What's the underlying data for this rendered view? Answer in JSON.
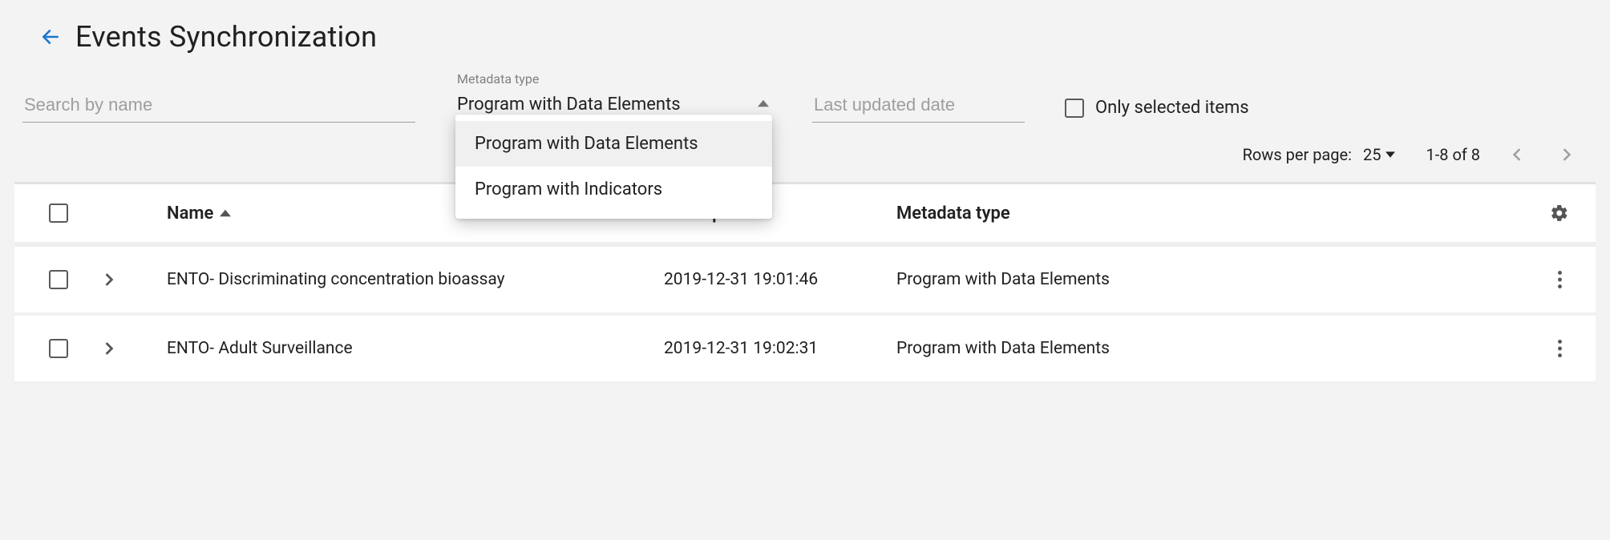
{
  "header": {
    "title": "Events Synchronization"
  },
  "filters": {
    "search_placeholder": "Search by name",
    "metadata_label": "Metadata type",
    "metadata_value": "Program with Data Elements",
    "metadata_options": [
      "Program with Data Elements",
      "Program with Indicators"
    ],
    "date_placeholder": "Last updated date",
    "only_selected_label": "Only selected items"
  },
  "pagination": {
    "rpp_label": "Rows per page:",
    "rpp_value": "25",
    "range": "1-8 of 8"
  },
  "table": {
    "columns": {
      "name": "Name",
      "last_updated": "Last updated",
      "metadata_type": "Metadata type"
    },
    "rows": [
      {
        "name": "ENTO- Discriminating concentration bioassay",
        "last_updated": "2019-12-31 19:01:46",
        "metadata_type": "Program with Data Elements"
      },
      {
        "name": "ENTO- Adult Surveillance",
        "last_updated": "2019-12-31 19:02:31",
        "metadata_type": "Program with Data Elements"
      }
    ]
  }
}
